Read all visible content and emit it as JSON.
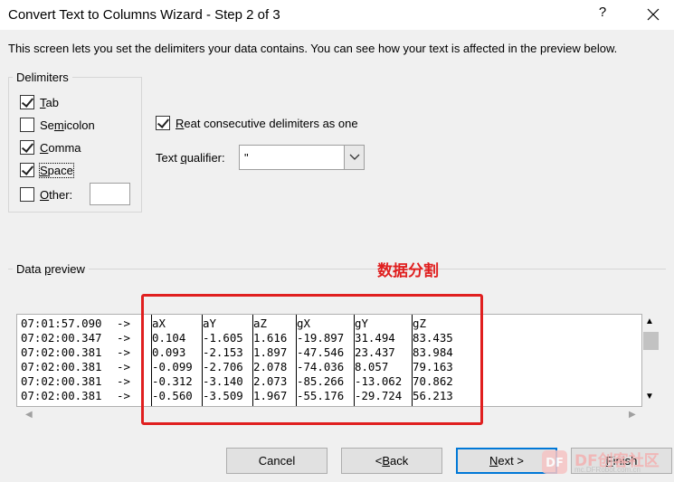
{
  "window": {
    "title": "Convert Text to Columns Wizard - Step 2 of 3",
    "help_label": "?",
    "close_label": "✕"
  },
  "intro": "This screen lets you set the delimiters your data contains.  You can see how your text is affected in the preview below.",
  "delimiters": {
    "group_label": "Delimiters",
    "tab": {
      "pre": "",
      "ul": "T",
      "post": "ab",
      "checked": true
    },
    "semicolon": {
      "pre": "Se",
      "ul": "m",
      "post": "icolon",
      "checked": false
    },
    "comma": {
      "pre": "",
      "ul": "C",
      "post": "omma",
      "checked": true
    },
    "space": {
      "pre": "",
      "ul": "S",
      "post": "pace",
      "checked": true
    },
    "other": {
      "pre": "",
      "ul": "O",
      "post": "ther:",
      "checked": false,
      "value": ""
    }
  },
  "treat_consecutive": {
    "pre": "",
    "ul": "R",
    "post": "eat consecutive delimiters as one",
    "checked": true
  },
  "text_qualifier": {
    "label_pre": "Text ",
    "label_ul": "q",
    "label_post": "ualifier:",
    "value": "\"",
    "dropdown_icon": "chevron-down-icon"
  },
  "preview": {
    "group_label_pre": "Data ",
    "group_label_ul": "p",
    "group_label_post": "review",
    "annotation": "数据分割",
    "rows": [
      [
        "07:01:57.090",
        "->",
        "aX",
        "aY",
        "aZ",
        "gX",
        "gY",
        "gZ"
      ],
      [
        "07:02:00.347",
        "->",
        "0.104",
        "-1.605",
        "1.616",
        "-19.897",
        "31.494",
        "83.435"
      ],
      [
        "07:02:00.381",
        "->",
        "0.093",
        "-2.153",
        "1.897",
        "-47.546",
        "23.437",
        "83.984"
      ],
      [
        "07:02:00.381",
        "->",
        "-0.099",
        "-2.706",
        "2.078",
        "-74.036",
        "8.057",
        "79.163"
      ],
      [
        "07:02:00.381",
        "->",
        "-0.312",
        "-3.140",
        "2.073",
        "-85.266",
        "-13.062",
        "70.862"
      ],
      [
        "07:02:00.381",
        "->",
        "-0.560",
        "-3.509",
        "1.967",
        "-55.176",
        "-29.724",
        "56.213"
      ]
    ]
  },
  "buttons": {
    "cancel": "Cancel",
    "back_pre": "< ",
    "back_ul": "B",
    "back_post": "ack",
    "next_pre": "",
    "next_ul": "N",
    "next_post": "ext >",
    "finish_pre": "",
    "finish_ul": "F",
    "finish_post": "inish"
  },
  "watermark": {
    "brand": "DF创客社区",
    "url": "mc.DFRobot.com.cn"
  }
}
